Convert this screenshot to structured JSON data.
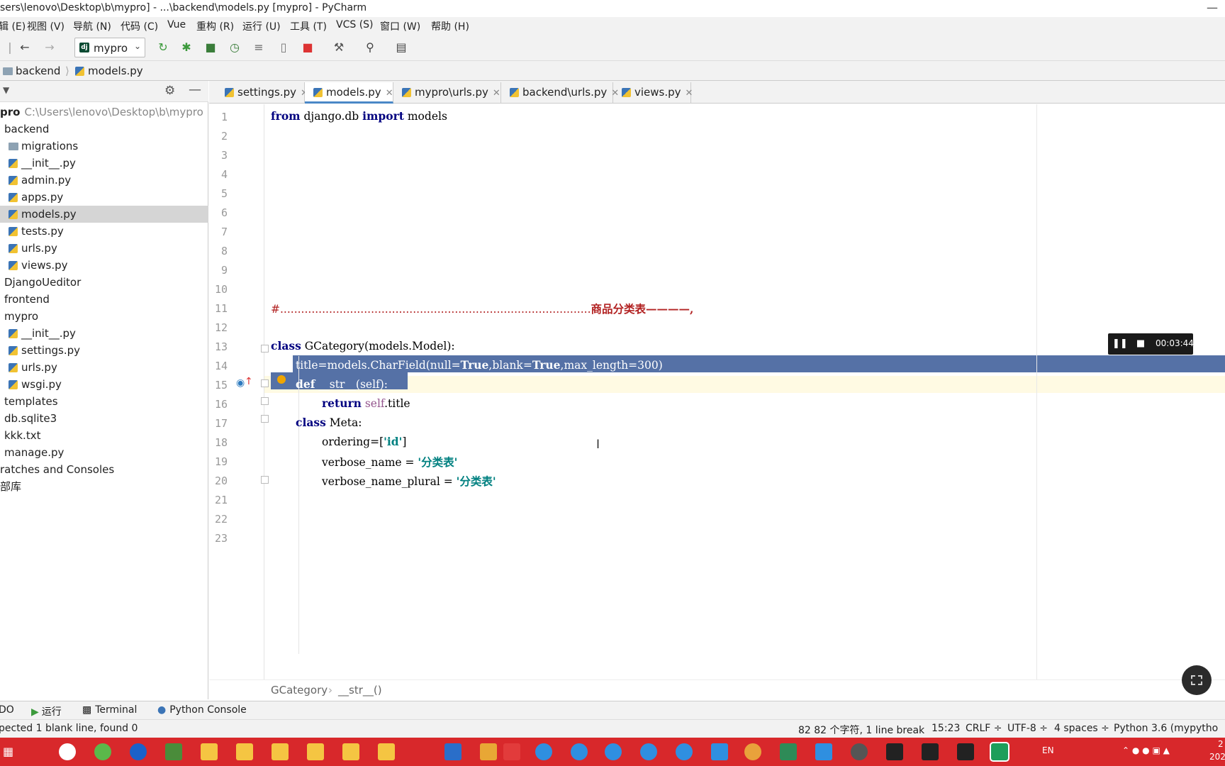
{
  "window": {
    "title": "sers\\lenovo\\Desktop\\b\\mypro] - ...\\backend\\models.py [mypro] - PyCharm",
    "minimize": "—"
  },
  "menu": [
    "辑 (E)",
    "视图 (V)",
    "导航 (N)",
    "代码 (C)",
    "Vue",
    "重构 (R)",
    "运行 (U)",
    "工具 (T)",
    "VCS (S)",
    "窗口 (W)",
    "帮助 (H)"
  ],
  "toolbar": {
    "run_config": "mypro",
    "run_config_badge": "dj",
    "icons": [
      "back-icon",
      "forward-icon",
      "rerun-icon",
      "debug-icon",
      "coverage-icon",
      "profile-icon",
      "concurrency-icon",
      "device-icon",
      "stop-icon",
      "wrench-icon",
      "search-icon",
      "structure-icon"
    ]
  },
  "nav": {
    "crumbs": [
      "backend",
      "models.py"
    ]
  },
  "project": {
    "root_label": "pro",
    "root_path": "C:\\Users\\lenovo\\Desktop\\b\\mypro",
    "items": [
      {
        "label": "backend",
        "kind": "folder"
      },
      {
        "label": "migrations",
        "kind": "folder"
      },
      {
        "label": "__init__.py",
        "kind": "py"
      },
      {
        "label": "admin.py",
        "kind": "py"
      },
      {
        "label": "apps.py",
        "kind": "py"
      },
      {
        "label": "models.py",
        "kind": "py",
        "selected": true
      },
      {
        "label": "tests.py",
        "kind": "py"
      },
      {
        "label": "urls.py",
        "kind": "py"
      },
      {
        "label": "views.py",
        "kind": "py"
      },
      {
        "label": "DjangoUeditor",
        "kind": "folder"
      },
      {
        "label": "frontend",
        "kind": "folder"
      },
      {
        "label": "mypro",
        "kind": "folder"
      },
      {
        "label": "__init__.py",
        "kind": "py"
      },
      {
        "label": "settings.py",
        "kind": "py"
      },
      {
        "label": "urls.py",
        "kind": "py"
      },
      {
        "label": "wsgi.py",
        "kind": "py"
      },
      {
        "label": "templates",
        "kind": "folder"
      },
      {
        "label": "db.sqlite3",
        "kind": "file"
      },
      {
        "label": "kkk.txt",
        "kind": "file"
      },
      {
        "label": "manage.py",
        "kind": "py"
      },
      {
        "label": "ratches and Consoles",
        "kind": "none"
      },
      {
        "label": "部库",
        "kind": "none"
      }
    ]
  },
  "tabs": [
    {
      "label": "settings.py"
    },
    {
      "label": "models.py",
      "active": true
    },
    {
      "label": "mypro\\urls.py"
    },
    {
      "label": "backend\\urls.py"
    },
    {
      "label": "views.py"
    }
  ],
  "editor": {
    "line_numbers": [
      "1",
      "2",
      "3",
      "4",
      "5",
      "6",
      "7",
      "8",
      "9",
      "10",
      "11",
      "12",
      "13",
      "14",
      "15",
      "16",
      "17",
      "18",
      "19",
      "20",
      "21",
      "22",
      "23"
    ],
    "lines": {
      "l1_from": "from",
      "l1_mod": " django.db ",
      "l1_import": "import",
      "l1_name": " models",
      "l11_dots": "#.........................................................................................",
      "l11_text": "商品分类表————,",
      "l13_class": "class",
      "l13_rest": " GCategory(models.Model):",
      "l14_a": "title=models.CharField(null=",
      "l14_true1": "True",
      "l14_b": ",blank=",
      "l14_true2": "True",
      "l14_c": ",max_length=300)",
      "l15_def": "def",
      "l15_rest": " __str__(self):",
      "l16_return": "return",
      "l16_self": " self",
      "l16_rest": ".title",
      "l17_class": "class",
      "l17_rest": " Meta:",
      "l18_a": "ordering=[",
      "l18_str": "'id'",
      "l18_b": "]",
      "l19_a": "verbose_name = ",
      "l19_str": "'分类表'",
      "l20_a": "verbose_name_plural = ",
      "l20_str": "'分类表'"
    }
  },
  "editor_breadcrumb": [
    "GCategory",
    "›",
    "__str__()"
  ],
  "recorder": {
    "time": "00:03:44"
  },
  "toolwindows": [
    "DO",
    "运行",
    "Terminal",
    "Python Console"
  ],
  "status": {
    "message": "pected 1 blank line, found 0",
    "selection": "82 82 个字符, 1 line break",
    "position": "15:23",
    "line_sep": "CRLF ÷",
    "encoding": "UTF-8 ÷",
    "indent": "4 spaces ÷",
    "interpreter": "Python 3.6 (mypytho"
  },
  "taskbar": {
    "tray_lang": "EN",
    "tray_time_a": "2",
    "tray_time_b": "202"
  }
}
